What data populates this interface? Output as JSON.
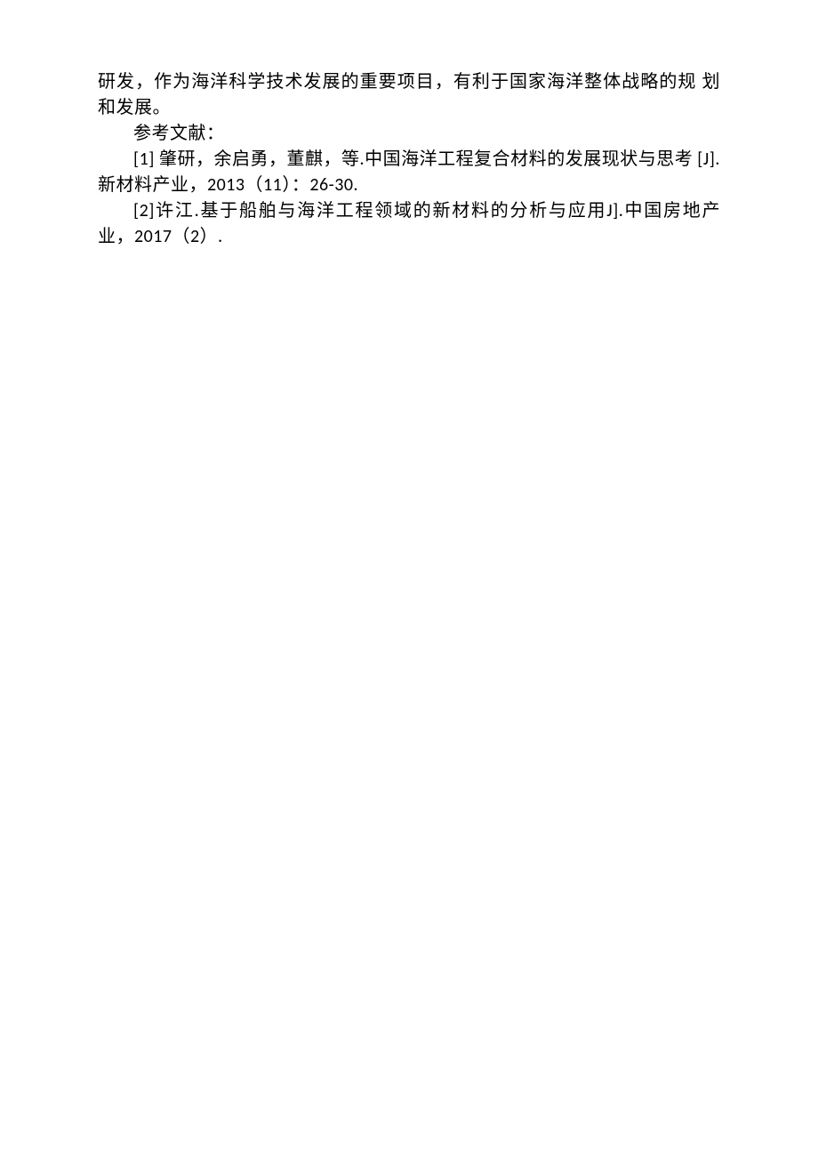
{
  "content": {
    "continuation": "研发，作为海洋科学技术发展的重要项目，有利于国家海洋整体战略的规 划和发展。",
    "ref_heading": "参考文献：",
    "ref1_prefix": "[1]",
    "ref1_text": " 肇研，余启勇，董麒，等.中国海洋工程复合材料的发展现状与思考 [J]. 新材料产业，2013（11）：26-30.",
    "ref2_prefix": "[2]",
    "ref2_text": "许江.基于船舶与海洋工程领域的新材料的分析与应用J].中国房地产业，2017（2）."
  }
}
